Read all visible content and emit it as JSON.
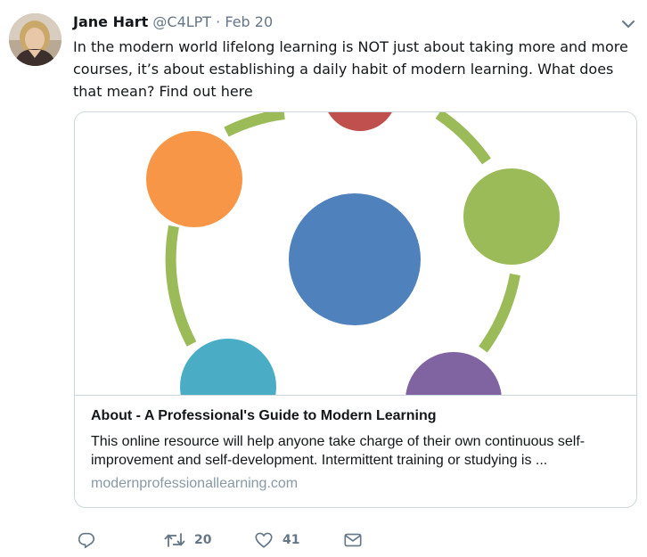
{
  "tweet": {
    "author_name": "Jane Hart",
    "author_handle": "@C4LPT",
    "separator": "·",
    "date": "Feb 20",
    "text": "In the modern world lifelong learning is NOT just about taking more and more courses, it’s about establishing a daily habit of modern learning. What does that mean? Find out here"
  },
  "card": {
    "title": "About - A Professional's Guide to Modern Learning",
    "description": "This online resource will help anyone take charge of their own continuous self-improvement and self-development. Intermittent training or studying is ...",
    "domain": "modernprofessionallearning.com",
    "colors": {
      "ring": "#9bbb59",
      "center": "#4f81bd",
      "red": "#c0504d",
      "orange": "#f79646",
      "green": "#9bbb59",
      "teal": "#4bacc6",
      "purple": "#8064a2"
    }
  },
  "actions": {
    "reply_icon": "reply-icon",
    "retweet_icon": "retweet-icon",
    "retweet_count": "20",
    "like_icon": "heart-icon",
    "like_count": "41",
    "dm_icon": "envelope-icon"
  },
  "colors": {
    "text_primary": "#14171a",
    "text_secondary": "#657786",
    "border": "#ccd6dd",
    "domain_text": "#8899a6"
  }
}
